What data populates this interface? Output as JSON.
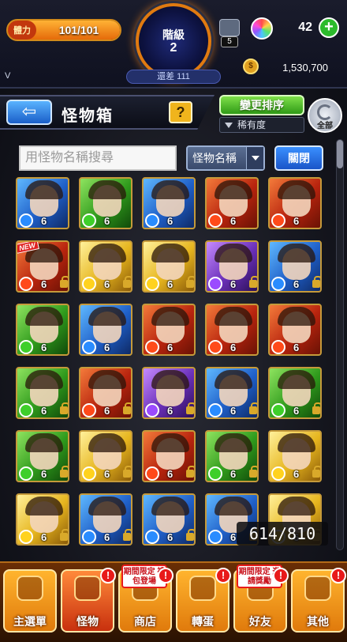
{
  "status": {
    "stamina_label": "體力",
    "stamina": "101/101",
    "stamina_fraction": 1.0,
    "rank_label": "階級",
    "rank": "2",
    "rank_gap": "還差 111",
    "gift_count": "5",
    "orb_count": "42",
    "coin_count": "1,530,700",
    "version_mark": "V"
  },
  "header": {
    "title": "怪物箱",
    "help": "?",
    "sort_button": "變更排序",
    "sort_field": "稀有度",
    "all_button": "全部"
  },
  "search": {
    "placeholder": "用怪物名稱搜尋",
    "select_value": "怪物名稱",
    "close_button": "關閉"
  },
  "box_counter": "614/810",
  "colors": {
    "accent": "#e07a10",
    "stamina": "#ffb235",
    "nav": "#ffb42e"
  },
  "monsters": [
    {
      "el": "water",
      "lvl": "6",
      "lock": false,
      "new": false
    },
    {
      "el": "wood",
      "lvl": "6",
      "lock": false,
      "new": false
    },
    {
      "el": "water",
      "lvl": "6",
      "lock": false,
      "new": false
    },
    {
      "el": "fire",
      "lvl": "6",
      "lock": false,
      "new": false
    },
    {
      "el": "fire",
      "lvl": "6",
      "lock": false,
      "new": false
    },
    {
      "el": "fire",
      "lvl": "6",
      "lock": true,
      "new": true
    },
    {
      "el": "light",
      "lvl": "6",
      "lock": true,
      "new": false
    },
    {
      "el": "light",
      "lvl": "6",
      "lock": true,
      "new": false
    },
    {
      "el": "dark",
      "lvl": "6",
      "lock": true,
      "new": false
    },
    {
      "el": "water",
      "lvl": "6",
      "lock": true,
      "new": false
    },
    {
      "el": "wood",
      "lvl": "6",
      "lock": false,
      "new": false
    },
    {
      "el": "water",
      "lvl": "6",
      "lock": false,
      "new": false
    },
    {
      "el": "fire",
      "lvl": "6",
      "lock": false,
      "new": false
    },
    {
      "el": "fire",
      "lvl": "6",
      "lock": false,
      "new": false
    },
    {
      "el": "fire",
      "lvl": "6",
      "lock": false,
      "new": false
    },
    {
      "el": "wood",
      "lvl": "6",
      "lock": true,
      "new": false
    },
    {
      "el": "fire",
      "lvl": "6",
      "lock": true,
      "new": false
    },
    {
      "el": "dark",
      "lvl": "6",
      "lock": true,
      "new": false
    },
    {
      "el": "water",
      "lvl": "6",
      "lock": true,
      "new": false
    },
    {
      "el": "wood",
      "lvl": "6",
      "lock": true,
      "new": false
    },
    {
      "el": "wood",
      "lvl": "6",
      "lock": true,
      "new": false
    },
    {
      "el": "light",
      "lvl": "6",
      "lock": true,
      "new": false
    },
    {
      "el": "fire",
      "lvl": "6",
      "lock": true,
      "new": false
    },
    {
      "el": "wood",
      "lvl": "6",
      "lock": true,
      "new": false
    },
    {
      "el": "light",
      "lvl": "6",
      "lock": true,
      "new": false
    },
    {
      "el": "light",
      "lvl": "6",
      "lock": true,
      "new": false
    },
    {
      "el": "water",
      "lvl": "6",
      "lock": true,
      "new": false
    },
    {
      "el": "water",
      "lvl": "6",
      "lock": true,
      "new": false
    },
    {
      "el": "water",
      "lvl": "6",
      "lock": true,
      "new": false
    },
    {
      "el": "light",
      "lvl": "6",
      "lock": true,
      "new": false
    }
  ],
  "nav": [
    {
      "label": "主選單",
      "badge": "",
      "promo": "",
      "active": false,
      "icon": "house-icon"
    },
    {
      "label": "怪物",
      "badge": "!",
      "promo": "",
      "active": true,
      "icon": "monster-icon"
    },
    {
      "label": "商店",
      "badge": "!",
      "promo": "期間限定 禮包登場",
      "active": false,
      "icon": "shop-icon"
    },
    {
      "label": "轉蛋",
      "badge": "!",
      "promo": "",
      "active": false,
      "icon": "egg-icon"
    },
    {
      "label": "好友",
      "badge": "!",
      "promo": "期間限定 邀請獎勵",
      "active": false,
      "icon": "friends-icon"
    },
    {
      "label": "其他",
      "badge": "!",
      "promo": "",
      "active": false,
      "icon": "other-icon"
    }
  ]
}
